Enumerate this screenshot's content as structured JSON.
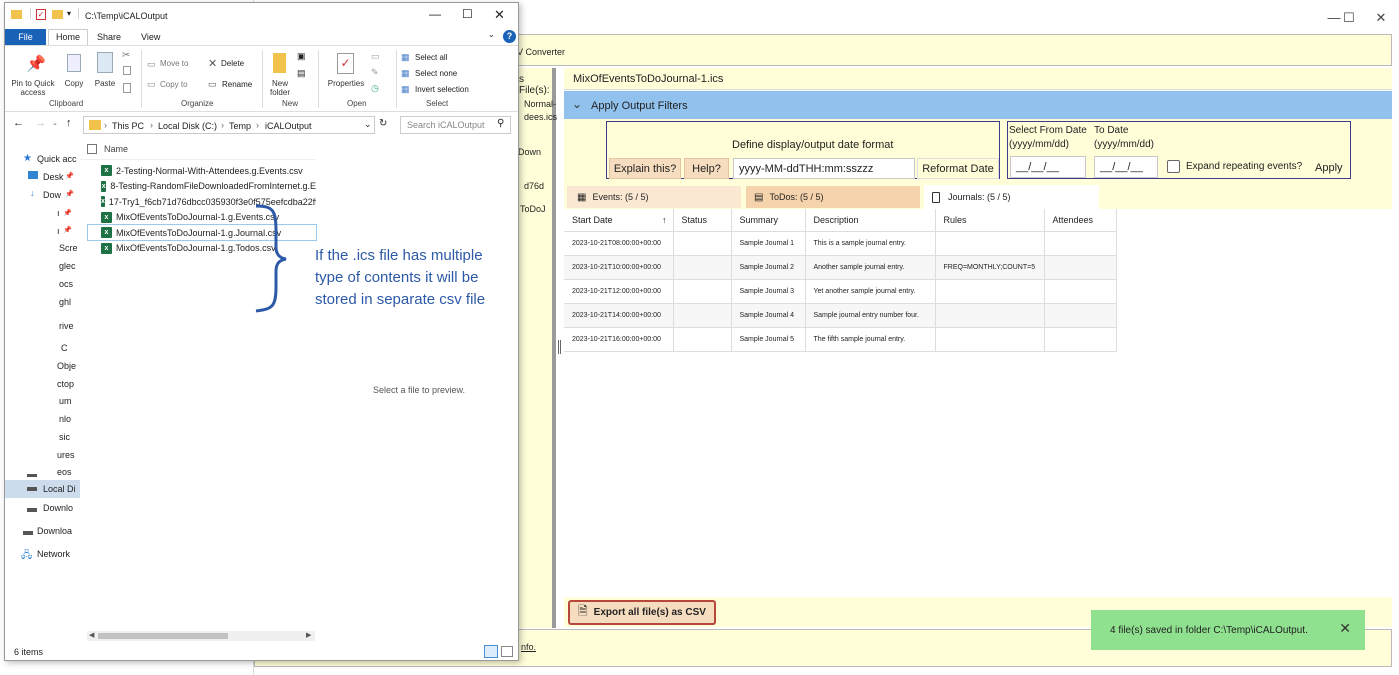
{
  "converter": {
    "title_partial": "V Converter",
    "files_label": "s File(s):",
    "selected_file": "MixOfEventsToDoJournal-1.ics",
    "file_list_partial": [
      "Normal-",
      "dees.ics",
      "Down",
      "d76d",
      "ToDoJ"
    ],
    "filters_header": "Apply Output Filters",
    "date_format_title": "Define display/output date format",
    "explain_btn": "Explain this?",
    "help_btn": "Help?",
    "date_format_value": "yyyy-MM-ddTHH:mm:sszzz",
    "reformat_btn": "Reformat Date",
    "from_date_label": "Select From Date",
    "from_date_hint": "(yyyy/mm/dd)",
    "to_date_label": "To Date",
    "to_date_hint": "(yyyy/mm/dd)",
    "date_placeholder": "__/__/__",
    "expand_label": "Expand repeating events?",
    "apply_btn": "Apply",
    "tabs": [
      {
        "label": "Events: (5 / 5)",
        "icon": "calendar-icon"
      },
      {
        "label": "ToDos: (5 / 5)",
        "icon": "list-icon"
      },
      {
        "label": "Journals: (5 / 5)",
        "icon": "journal-icon"
      }
    ],
    "table": {
      "columns": [
        "Start Date",
        "Status",
        "Summary",
        "Description",
        "Rules",
        "Attendees"
      ],
      "rows": [
        [
          "2023-10-21T08:00:00+00:00",
          "",
          "Sample Journal 1",
          "This is a sample journal entry.",
          "",
          ""
        ],
        [
          "2023-10-21T10:00:00+00:00",
          "",
          "Sample Journal 2",
          "Another sample journal entry.",
          "FREQ=MONTHLY;COUNT=5",
          ""
        ],
        [
          "2023-10-21T12:00:00+00:00",
          "",
          "Sample Journal 3",
          "Yet another sample journal entry.",
          "",
          ""
        ],
        [
          "2023-10-21T14:00:00+00:00",
          "",
          "Sample Journal 4",
          "Sample journal entry number four.",
          "",
          ""
        ],
        [
          "2023-10-21T16:00:00+00:00",
          "",
          "Sample Journal 5",
          "The fifth sample journal entry.",
          "",
          ""
        ]
      ]
    },
    "export_btn": "Export all file(s) as CSV",
    "footer_link": "nfo.",
    "toast_text": "4 file(s) saved in folder C:\\Temp\\iCALOutput.",
    "window_controls": {
      "minimize": "—",
      "maximize": "☐",
      "close": "✕"
    }
  },
  "explorer": {
    "title": "C:\\Temp\\iCALOutput",
    "ribbon_tabs": [
      "File",
      "Home",
      "Share",
      "View"
    ],
    "clipboard": {
      "pin": "Pin to Quick access",
      "copy": "Copy",
      "paste": "Paste",
      "group": "Clipboard"
    },
    "organize": {
      "move": "Move to",
      "copyto": "Copy to",
      "delete": "Delete",
      "rename": "Rename",
      "group": "Organize"
    },
    "new": {
      "folder": "New folder",
      "group": "New"
    },
    "open": {
      "properties": "Properties",
      "group": "Open"
    },
    "select": {
      "all": "Select all",
      "none": "Select none",
      "invert": "Invert selection",
      "group": "Select"
    },
    "breadcrumb": [
      "This PC",
      "Local Disk (C:)",
      "Temp",
      "iCALOutput"
    ],
    "search_placeholder": "Search iCALOutput",
    "nav_items": [
      "Quick acc",
      "Desk",
      "Dow",
      "ı",
      "ı",
      "Scre",
      "glec",
      "ocs",
      "ghl",
      "rive",
      "C",
      "Obje",
      "ctop",
      "um",
      "nlo",
      "sic",
      "ures",
      "eos",
      "Local Di",
      "Downlo",
      "Downloa",
      "Network"
    ],
    "column_name": "Name",
    "files": [
      "2-Testing-Normal-With-Attendees.g.Events.csv",
      "8-Testing-RandomFileDownloadedFromInternet.g.E",
      "17-Try1_f6cb71d76dbcc035930f3e0f575eefcdba22ff7",
      "MixOfEventsToDoJournal-1.g.Events.csv",
      "MixOfEventsToDoJournal-1.g.Journal.csv",
      "MixOfEventsToDoJournal-1.g.Todos.csv"
    ],
    "annotation": "If the .ics file has multiple type of contents it will be stored in separate csv file",
    "preview_text": "Select a file to preview.",
    "status": "6 items"
  }
}
